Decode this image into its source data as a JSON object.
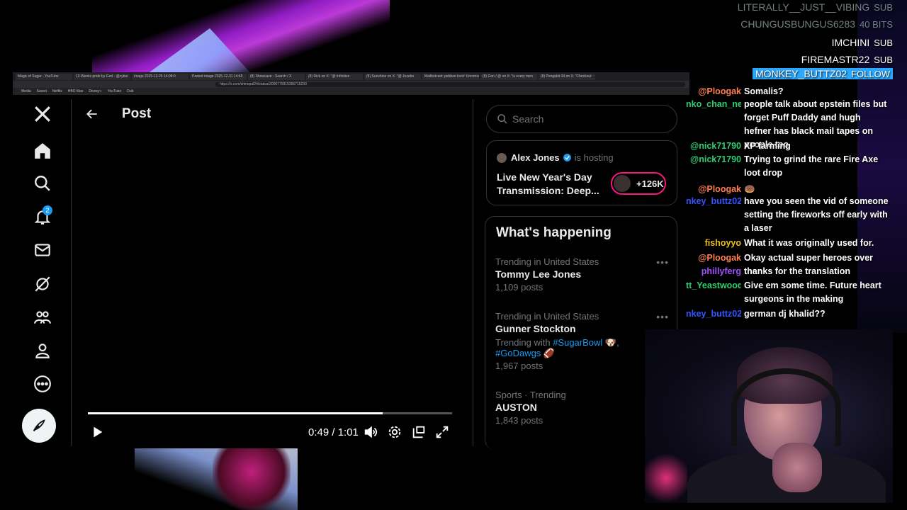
{
  "browser": {
    "tabs": [
      "Magic of Sugar - YouTube",
      "10 Weeks pride by God - @cyber",
      "image 2025-12-25 14:08:0",
      "Pasted image 2025-12-31 14:45",
      "(8) Showcase - Search / X",
      "(8) Rick on X: \"@ Infinitive",
      "(8) Sunshine on X: \"@ Jozebo",
      "Mailbotcast: pebbee lovin' Unconso",
      "(8) Gun / @ on X: \"is every men",
      "(8) Pengabit 34 on X: \"Checkout"
    ],
    "url": "https://x.com/shinepal24/status/2006770015356715230",
    "bookmarks": [
      "Media",
      "Saved",
      "Netflix",
      "HBO Max",
      "Disney+",
      "YouTube",
      "Dub"
    ]
  },
  "nav": {
    "notification_count": "2"
  },
  "main": {
    "title": "Post",
    "video": {
      "time": "0:49 / 1:01",
      "progress": 0.81
    }
  },
  "sidebar": {
    "search_placeholder": "Search",
    "space": {
      "host": "Alex Jones",
      "hosting_label": "is hosting",
      "title": "Live New Year's Day Transmission: Deep...",
      "listeners": "+126K"
    },
    "happening_title": "What's happening",
    "trends": [
      {
        "meta": "Trending in United States",
        "name": "Tommy Lee Jones",
        "posts": "1,109 posts"
      },
      {
        "meta": "Trending in United States",
        "name": "Gunner Stockton",
        "with_label": "Trending with",
        "tags": [
          "#SugarBowl",
          "#GoDawgs"
        ],
        "posts": "1,967 posts"
      },
      {
        "meta": "Sports · Trending",
        "name": "AUSTON",
        "posts": "1,843 posts"
      }
    ]
  },
  "chat": {
    "events": [
      {
        "user": "LITERALLY__JUST__VIBING",
        "kind": "SUB"
      },
      {
        "user": "CHUNGUSBUNGUS6283",
        "kind": "40 BITS"
      },
      {
        "user": "IMCHINI",
        "kind": "SUB"
      },
      {
        "user": "FIREMASTR22",
        "kind": "SUB"
      },
      {
        "user": "MONKEY_BUTTZ02",
        "kind": "FOLLOW"
      }
    ],
    "messages": [
      {
        "user": "@Ploogak",
        "color": "#ff7f50",
        "text": "Somalis?"
      },
      {
        "user": "nko_chan_ne",
        "color": "#2ecc71",
        "text": "people talk about epstein files but forget Puff Daddy and hugh hefner has black mail tapes on people too"
      },
      {
        "user": "@nick71790",
        "color": "#2ecc71",
        "text": "XP farming"
      },
      {
        "user": "@nick71790",
        "color": "#2ecc71",
        "text": "Trying to grind the rare Fire Axe loot drop"
      },
      {
        "user": "@Ploogak",
        "color": "#ff7f50",
        "text": "🍩"
      },
      {
        "user": "nkey_buttz02",
        "color": "#3355ff",
        "text": "have you seen the vid of someone setting the fireworks off early with a laser"
      },
      {
        "user": "fishoyyo",
        "color": "#e8c020",
        "text": "What it was originally used for."
      },
      {
        "user": "@Ploogak",
        "color": "#ff7f50",
        "text": "Okay actual super heroes over ther"
      },
      {
        "user": "phillyferg",
        "color": "#a050ff",
        "text": "thanks for the translation"
      },
      {
        "user": "tt_Yeastwood",
        "color": "#2ecc71",
        "text": "Give em some time. Future heart surgeons in the making"
      },
      {
        "user": "nkey_buttz02",
        "color": "#3355ff",
        "text": "german dj khalid??"
      }
    ]
  },
  "colors": {
    "accent": "#1d9bf0",
    "live_ring": "#f91880",
    "background": "#000000"
  }
}
